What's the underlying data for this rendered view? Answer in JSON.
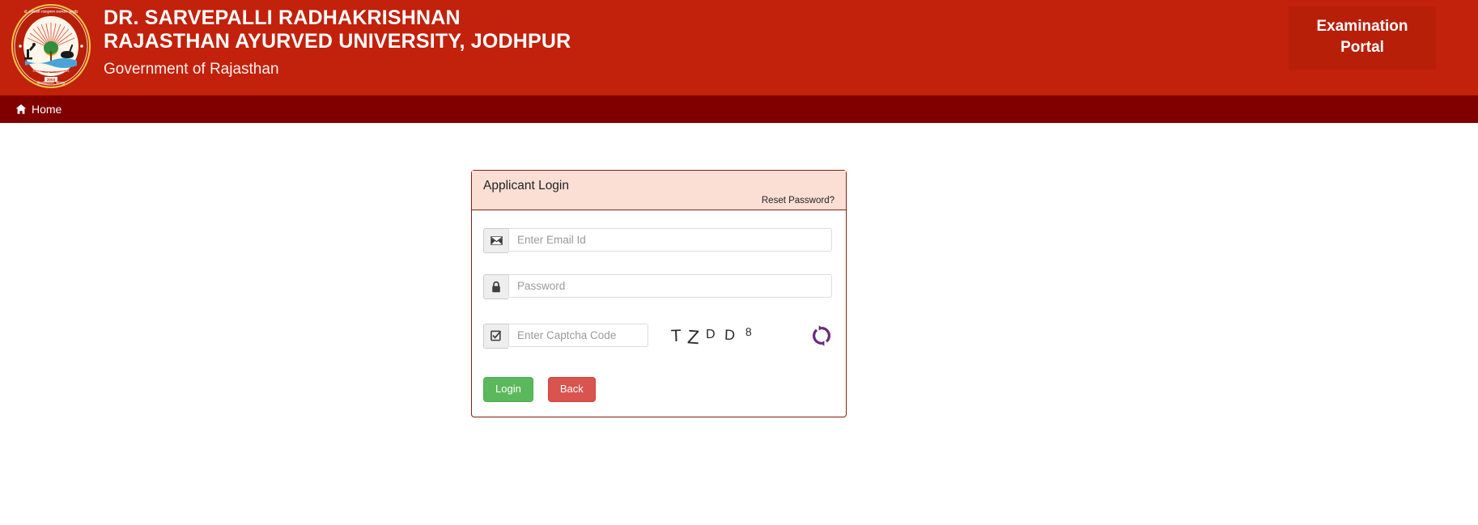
{
  "header": {
    "university_line1": "DR. SARVEPALLI RADHAKRISHNAN",
    "university_line2": "RAJASTHAN AYURVED UNIVERSITY, JODHPUR",
    "government_line": "Government of Rajasthan",
    "portal_badge_line1": "Examination",
    "portal_badge_line2": "Portal",
    "logo_year": "2003",
    "colors": {
      "header_bg": "#c2210b",
      "portal_badge_bg": "#b81f09",
      "navbar_bg": "#800000"
    }
  },
  "nav": {
    "items": [
      {
        "label": "Home",
        "icon": "home-icon"
      }
    ]
  },
  "login_card": {
    "title": "Applicant Login",
    "reset_link_label": "Reset Password?",
    "email": {
      "placeholder": "Enter Email Id",
      "value": "",
      "icon": "envelope-icon"
    },
    "password": {
      "placeholder": "Password",
      "value": "",
      "icon": "lock-icon"
    },
    "captcha": {
      "placeholder": "Enter Captcha Code",
      "value": "",
      "icon": "checkbox-check-icon",
      "code": "TZDD8",
      "characters": [
        "T",
        "Z",
        "D",
        "D",
        "8"
      ],
      "refresh_icon": "refresh-icon",
      "refresh_color": "#6a2a7a"
    },
    "buttons": {
      "login_label": "Login",
      "back_label": "Back",
      "login_color": "#5cb85c",
      "back_color": "#d9534f"
    },
    "colors": {
      "card_border": "#8a1f13",
      "card_header_bg": "#fbdfd5"
    }
  }
}
